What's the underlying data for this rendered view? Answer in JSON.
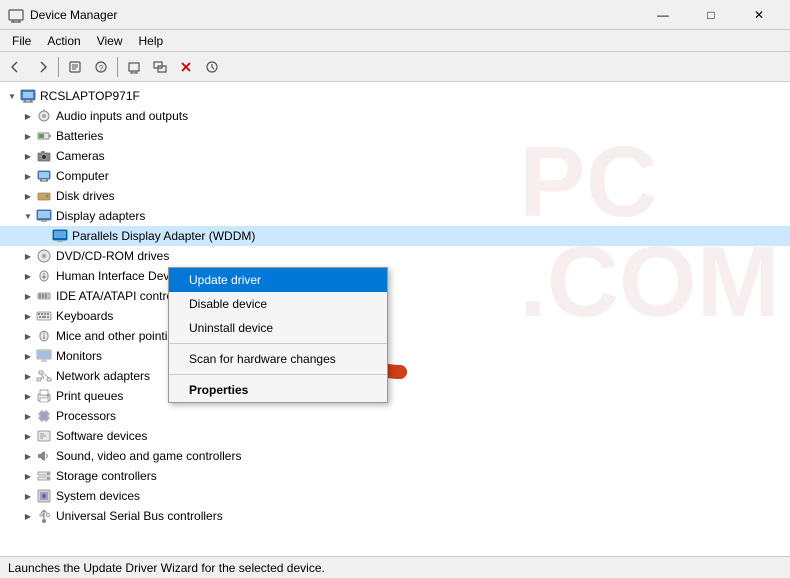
{
  "titlebar": {
    "title": "Device Manager",
    "icon": "⚙",
    "minimize": "—",
    "maximize": "□",
    "close": "✕"
  },
  "menubar": {
    "items": [
      "File",
      "Action",
      "View",
      "Help"
    ]
  },
  "toolbar": {
    "buttons": [
      "←",
      "→",
      "⊟",
      "⊞",
      "?",
      "⊟",
      "🖥",
      "⊡",
      "✕",
      "⊕"
    ]
  },
  "tree": {
    "root": "RCSLAPTOP971F",
    "items": [
      {
        "label": "Audio inputs and outputs",
        "level": 1,
        "expanded": false,
        "icon": "audio"
      },
      {
        "label": "Batteries",
        "level": 1,
        "expanded": false,
        "icon": "battery"
      },
      {
        "label": "Cameras",
        "level": 1,
        "expanded": false,
        "icon": "camera"
      },
      {
        "label": "Computer",
        "level": 1,
        "expanded": false,
        "icon": "computer"
      },
      {
        "label": "Disk drives",
        "level": 1,
        "expanded": false,
        "icon": "disk"
      },
      {
        "label": "Display adapters",
        "level": 1,
        "expanded": true,
        "icon": "display"
      },
      {
        "label": "Parallels Display Adapter (WDDM)",
        "level": 2,
        "expanded": false,
        "icon": "parallels",
        "selected": true
      },
      {
        "label": "DVD/CD-ROM drives",
        "level": 1,
        "expanded": false,
        "icon": "dvd"
      },
      {
        "label": "Human Interface Devices",
        "level": 1,
        "expanded": false,
        "icon": "hid"
      },
      {
        "label": "IDE ATA/ATAPI controllers",
        "level": 1,
        "expanded": false,
        "icon": "ide"
      },
      {
        "label": "Keyboards",
        "level": 1,
        "expanded": false,
        "icon": "keyboard"
      },
      {
        "label": "Mice and other pointing devices",
        "level": 1,
        "expanded": false,
        "icon": "mouse"
      },
      {
        "label": "Monitors",
        "level": 1,
        "expanded": false,
        "icon": "monitor"
      },
      {
        "label": "Network adapters",
        "level": 1,
        "expanded": false,
        "icon": "network"
      },
      {
        "label": "Print queues",
        "level": 1,
        "expanded": false,
        "icon": "printer"
      },
      {
        "label": "Processors",
        "level": 1,
        "expanded": false,
        "icon": "processor"
      },
      {
        "label": "Software devices",
        "level": 1,
        "expanded": false,
        "icon": "software"
      },
      {
        "label": "Sound, video and game controllers",
        "level": 1,
        "expanded": false,
        "icon": "sound"
      },
      {
        "label": "Storage controllers",
        "level": 1,
        "expanded": false,
        "icon": "storage"
      },
      {
        "label": "System devices",
        "level": 1,
        "expanded": false,
        "icon": "system"
      },
      {
        "label": "Universal Serial Bus controllers",
        "level": 1,
        "expanded": false,
        "icon": "usb"
      }
    ]
  },
  "contextmenu": {
    "items": [
      {
        "label": "Update driver",
        "highlighted": true
      },
      {
        "label": "Disable device",
        "highlighted": false
      },
      {
        "label": "Uninstall device",
        "highlighted": false
      },
      {
        "label": "Scan for hardware changes",
        "highlighted": false
      },
      {
        "label": "Properties",
        "highlighted": false,
        "bold": true
      }
    ]
  },
  "statusbar": {
    "text": "Launches the Update Driver Wizard for the selected device."
  }
}
